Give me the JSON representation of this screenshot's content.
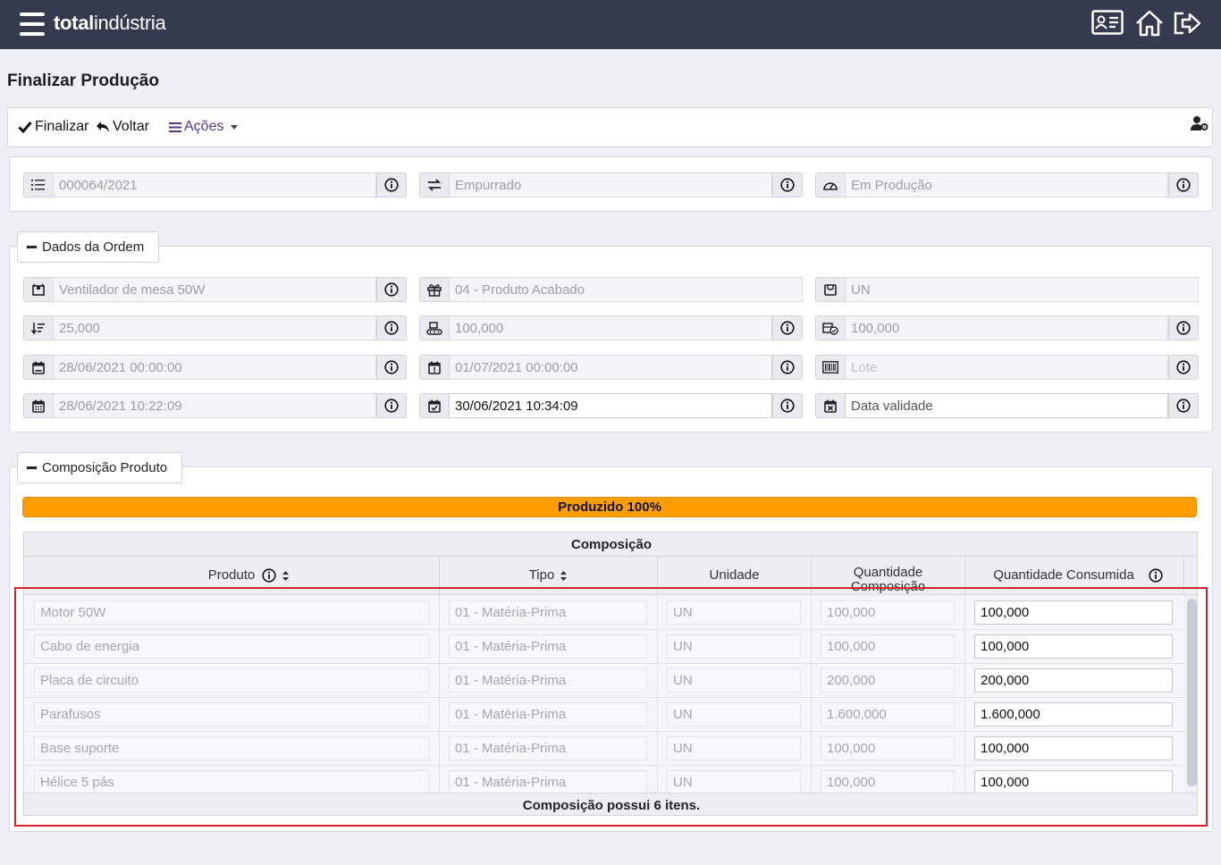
{
  "app": {
    "logo_bold": "total",
    "logo_light": "indústria"
  },
  "page": {
    "title": "Finalizar Produção"
  },
  "toolbar": {
    "finalizar_label": "Finalizar",
    "voltar_label": "Voltar",
    "acoes_label": "Ações"
  },
  "header_fields": {
    "ordem_numero": "000064/2021",
    "tipo_ordem": "Empurrado",
    "status": "Em Produção"
  },
  "dados_ordem": {
    "legend": "Dados da Ordem",
    "produto": "Ventilador de mesa 50W",
    "tipo_produto": "04 - Produto Acabado",
    "unidade": "UN",
    "quantidade_ordem": "25,000",
    "quantidade_produzida": "100,000",
    "quantidade_total": "100,000",
    "data_inicio_prevista": "28/06/2021 00:00:00",
    "data_fim_prevista": "01/07/2021 00:00:00",
    "lote_placeholder": "Lote",
    "data_inicio_real": "28/06/2021 10:22:09",
    "data_fim_real": "30/06/2021 10:34:09",
    "data_validade_placeholder": "Data validade"
  },
  "composicao": {
    "legend": "Composição Produto",
    "progress_label": "Produzido 100%",
    "progress_value": 100,
    "grid_title": "Composição",
    "columns": {
      "produto": "Produto",
      "tipo": "Tipo",
      "unidade": "Unidade",
      "qtd_composicao": "Quantidade Composição",
      "qtd_consumida": "Quantidade Consumida"
    },
    "rows": [
      {
        "produto": "Motor 50W",
        "tipo": "01 - Matéria-Prima",
        "unidade": "UN",
        "qtd_composicao": "100,000",
        "qtd_consumida": "100,000"
      },
      {
        "produto": "Cabo de energia",
        "tipo": "01 - Matéria-Prima",
        "unidade": "UN",
        "qtd_composicao": "100,000",
        "qtd_consumida": "100,000"
      },
      {
        "produto": "Placa de circuito",
        "tipo": "01 - Matéria-Prima",
        "unidade": "UN",
        "qtd_composicao": "200,000",
        "qtd_consumida": "200,000"
      },
      {
        "produto": "Parafusos",
        "tipo": "01 - Matéria-Prima",
        "unidade": "UN",
        "qtd_composicao": "1.600,000",
        "qtd_consumida": "1.600,000"
      },
      {
        "produto": "Base suporte",
        "tipo": "01 - Matéria-Prima",
        "unidade": "UN",
        "qtd_composicao": "100,000",
        "qtd_consumida": "100,000"
      },
      {
        "produto": "Hélice 5 pás",
        "tipo": "01 - Matéria-Prima",
        "unidade": "UN",
        "qtd_composicao": "100,000",
        "qtd_consumida": "100,000"
      }
    ],
    "footer": "Composição possui 6 itens."
  },
  "colors": {
    "topbar": "#363a4f",
    "progress": "#ff9e02",
    "acoes": "#4e3a8c",
    "highlight": "#d6232e"
  }
}
